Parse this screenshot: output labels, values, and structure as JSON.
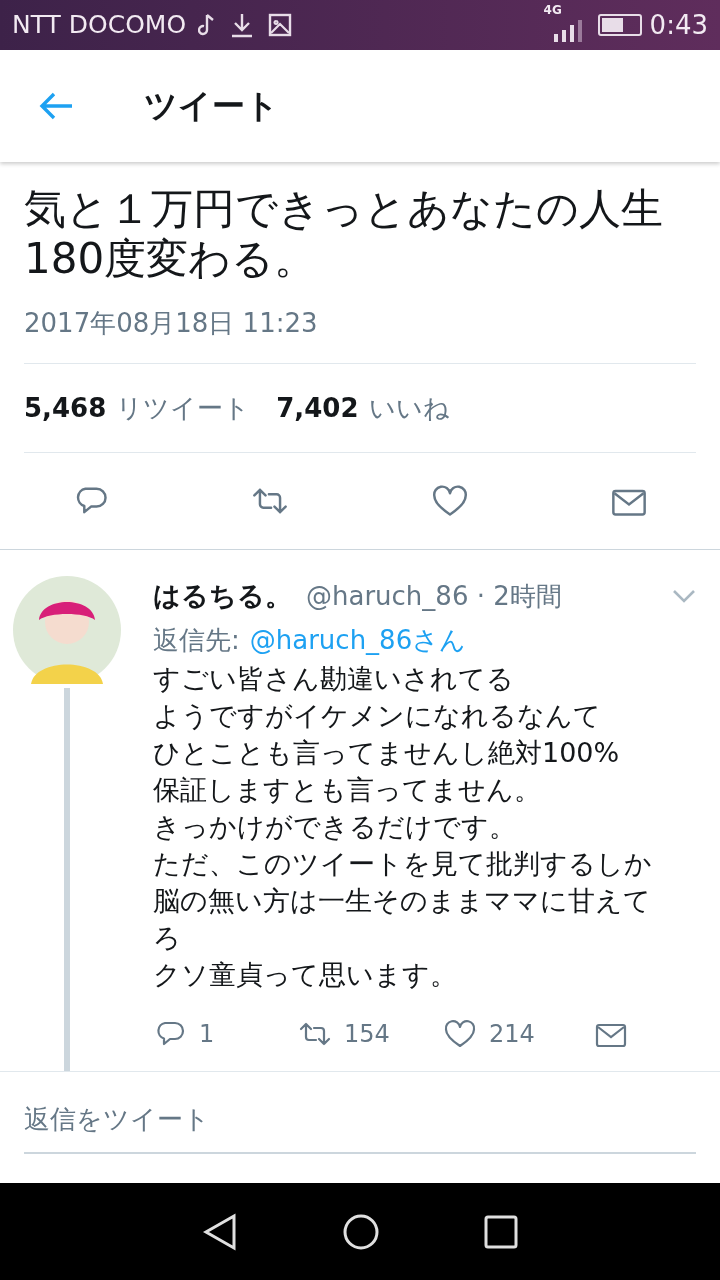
{
  "status_bar": {
    "carrier": "NTT DOCOMO",
    "network": "4G",
    "time": "0:43"
  },
  "header": {
    "title": "ツイート"
  },
  "tweet": {
    "text_lines": [
      "気と１万円できっとあなたの人生",
      "180度変わる。"
    ],
    "date": "2017年08月18日 11:23",
    "stats": [
      {
        "count": "5,468",
        "label": "リツイート"
      },
      {
        "count": "7,402",
        "label": "いいね"
      }
    ]
  },
  "reply": {
    "name": "はるちる。",
    "meta": "@haruch_86 · 2時間",
    "reply_to_label": "返信先:",
    "reply_to_user": "@haruch_86さん",
    "body_lines": [
      "すごい皆さん勘違いされてる",
      "ようですがイケメンになれるなんて",
      "ひとことも言ってませんし絶対100%",
      "保証しますとも言ってません。",
      "きっかけができるだけです。",
      "ただ、このツイートを見て批判するしか脳の無い方は一生そのままママに甘えてろ",
      "クソ童貞って思います。"
    ],
    "actions": [
      {
        "kind": "reply",
        "count": "1"
      },
      {
        "kind": "retweet",
        "count": "154"
      },
      {
        "kind": "like",
        "count": "214"
      },
      {
        "kind": "message"
      }
    ]
  },
  "compose": {
    "placeholder": "返信をツイート"
  }
}
